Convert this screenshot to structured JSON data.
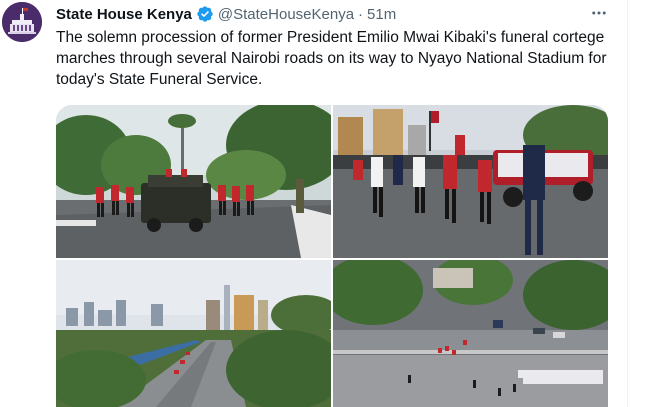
{
  "tweet": {
    "author_name": "State House Kenya",
    "verified_icon": "verified-badge-icon",
    "handle": "@StateHouseKenya",
    "separator": "·",
    "time": "51m",
    "more_icon": "more-horizontal-icon",
    "text": "The solemn procession of former President Emilio Mwai Kibaki's funeral cortege marches through several Nairobi roads on its way to Nyayo National Stadium for today's State Funeral Service."
  },
  "colors": {
    "verified": "#1d9bf0",
    "text_secondary": "#536471",
    "divider": "#eff3f4"
  }
}
